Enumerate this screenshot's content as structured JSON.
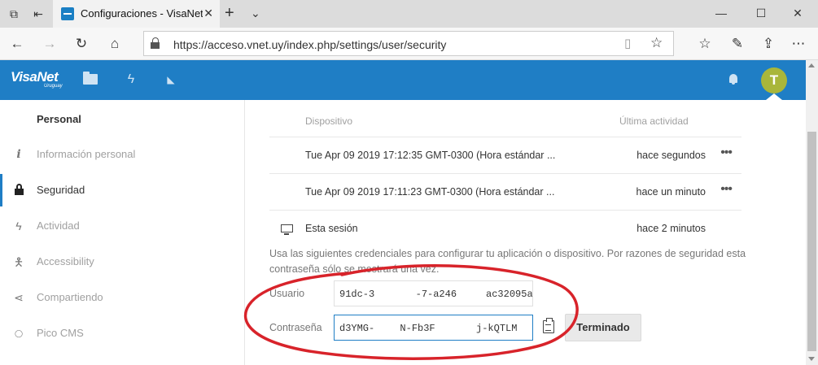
{
  "browser": {
    "tab_title": "Configuraciones - VisaNet",
    "url": "https://acceso.vnet.uy/index.php/settings/user/security",
    "icons": [
      "tab-actions-icon",
      "set-aside-tabs-icon",
      "new-tab-icon",
      "tab-list-icon",
      "minimize-icon",
      "maximize-icon",
      "close-icon",
      "back-icon",
      "forward-icon",
      "refresh-icon",
      "home-icon",
      "lock-icon",
      "reading-view-icon",
      "favorite-star-icon",
      "favorites-hub-icon",
      "pen-icon",
      "share-icon",
      "more-icon"
    ]
  },
  "app": {
    "logo": "VisaNet",
    "logo_sub": "Uruguay",
    "avatar_initial": "T",
    "brand_color": "#1f7ec5",
    "avatar_color": "#a9b63a"
  },
  "sidebar": {
    "header": "Personal",
    "items": [
      {
        "label": "Información personal",
        "icon": "info-icon"
      },
      {
        "label": "Seguridad",
        "icon": "lock-icon",
        "active": true
      },
      {
        "label": "Actividad",
        "icon": "lightning-icon"
      },
      {
        "label": "Accessibility",
        "icon": "accessibility-icon"
      },
      {
        "label": "Compartiendo",
        "icon": "share-icon"
      },
      {
        "label": "Pico CMS",
        "icon": "pico-cms-icon"
      }
    ]
  },
  "sessions": {
    "col_device": "Dispositivo",
    "col_activity": "Última actividad",
    "rows": [
      {
        "device": "Tue Apr 09 2019 17:12:35 GMT-0300 (Hora estándar ...",
        "activity": "hace segundos",
        "more": "•••"
      },
      {
        "device": "Tue Apr 09 2019 17:11:23 GMT-0300 (Hora estándar ...",
        "activity": "hace un minuto",
        "more": "•••"
      },
      {
        "device": "Esta sesión",
        "activity": "hace 2 minutos"
      }
    ]
  },
  "credentials": {
    "info": "Usa las siguientes credenciales para configurar tu aplicación o dispositivo. Por razones de seguridad esta contraseña sólo se mostrará una vez.",
    "user_label": "Usuario",
    "user_value": "91dc-3       -7-a246     ac32095a",
    "pass_label": "Contraseña",
    "pass_value": "d3YMG-     N-Fb3F       j-kQTLM",
    "done_button": "Terminado"
  }
}
